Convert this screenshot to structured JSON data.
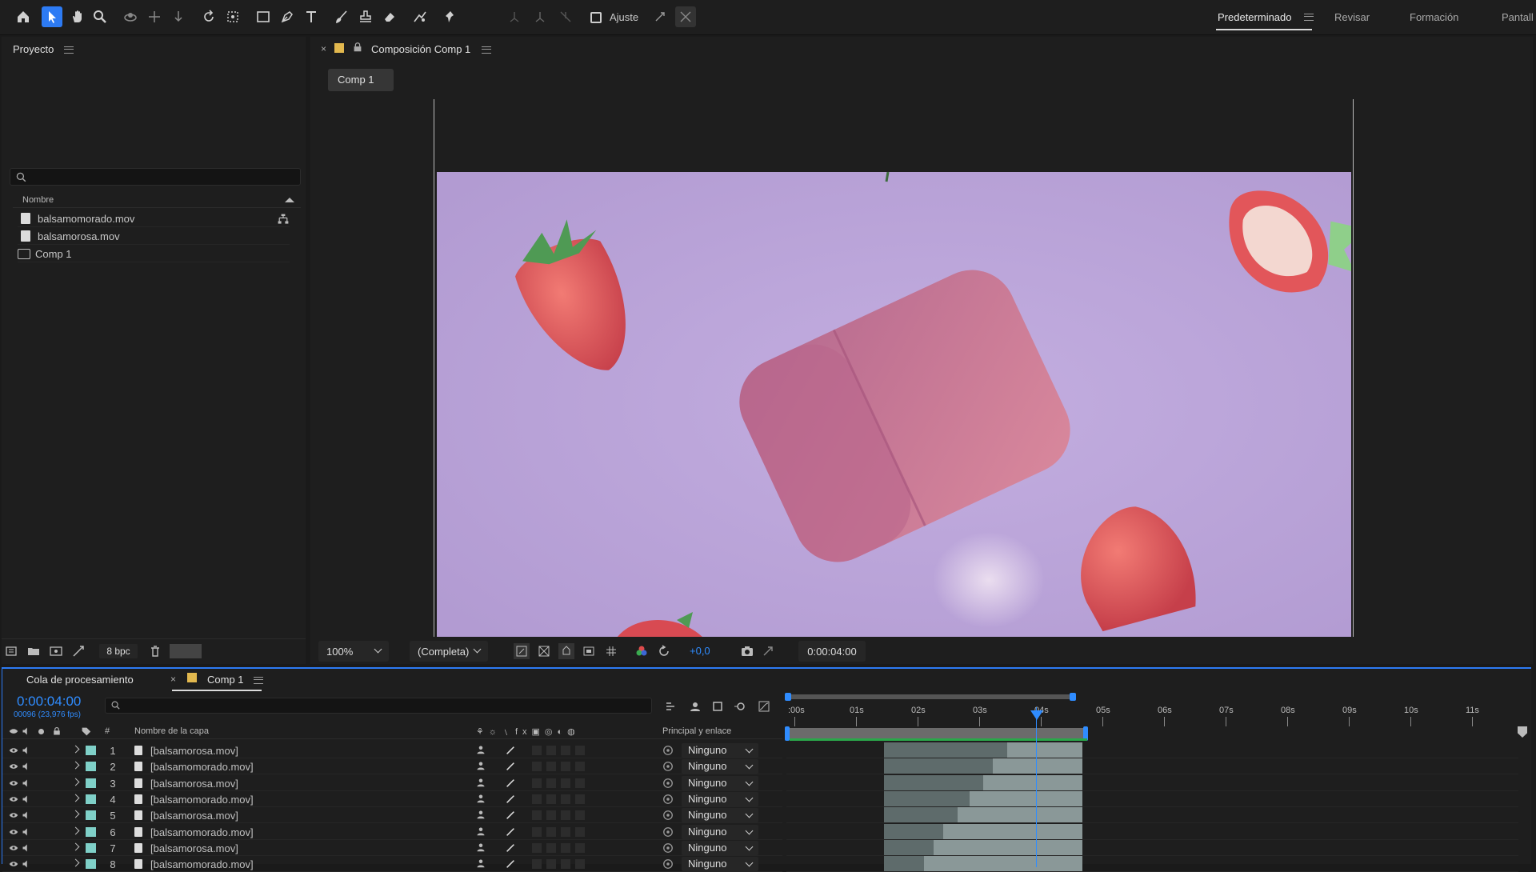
{
  "toolbar": {
    "tools": [
      "home-icon",
      "selection-icon",
      "hand-icon",
      "zoom-icon",
      "orbit-icon",
      "pan-icon",
      "dolly-icon",
      "rotate-icon",
      "anchor-icon",
      "rectangle-icon",
      "pen-icon",
      "type-icon",
      "brush-icon",
      "stamp-icon",
      "eraser-icon",
      "roto-brush-icon",
      "puppet-icon"
    ],
    "snap_label": "Ajuste",
    "workspaces": [
      "Predeterminado",
      "Revisar",
      "Formación",
      "Pantall"
    ]
  },
  "project": {
    "title": "Proyecto",
    "column_name": "Nombre",
    "items": [
      {
        "name": "balsamomorado.mov",
        "type": "file"
      },
      {
        "name": "balsamorosa.mov",
        "type": "file"
      },
      {
        "name": "Comp 1",
        "type": "comp"
      }
    ],
    "bpc": "8 bpc"
  },
  "viewer": {
    "close": "×",
    "title": "Composición Comp 1",
    "tab": "Comp 1",
    "zoom": "100%",
    "resolution": "(Completa)",
    "exposure": "+0,0",
    "timecode": "0:00:04:00"
  },
  "timeline": {
    "render_queue": "Cola de procesamiento",
    "tab": "Comp 1",
    "time": "0:00:04:00",
    "fps": "00096 (23,976 fps)",
    "col_num": "#",
    "col_name": "Nombre de la capa",
    "col_parent": "Principal y enlace",
    "ruler": [
      ":00s",
      "01s",
      "02s",
      "03s",
      "04s",
      "05s",
      "06s",
      "07s",
      "08s",
      "09s",
      "10s",
      "11s"
    ],
    "layers": [
      {
        "num": "1",
        "name": "[balsamorosa.mov]",
        "parent": "Ninguno",
        "light_start": 0.62
      },
      {
        "num": "2",
        "name": "[balsamomorado.mov]",
        "parent": "Ninguno",
        "light_start": 0.55
      },
      {
        "num": "3",
        "name": "[balsamorosa.mov]",
        "parent": "Ninguno",
        "light_start": 0.5
      },
      {
        "num": "4",
        "name": "[balsamomorado.mov]",
        "parent": "Ninguno",
        "light_start": 0.43
      },
      {
        "num": "5",
        "name": "[balsamorosa.mov]",
        "parent": "Ninguno",
        "light_start": 0.37
      },
      {
        "num": "6",
        "name": "[balsamomorado.mov]",
        "parent": "Ninguno",
        "light_start": 0.3
      },
      {
        "num": "7",
        "name": "[balsamorosa.mov]",
        "parent": "Ninguno",
        "light_start": 0.25
      },
      {
        "num": "8",
        "name": "[balsamomorado.mov]",
        "parent": "Ninguno",
        "light_start": 0.2
      }
    ]
  },
  "colors": {
    "accent": "#2d7bf4",
    "canvas": "#b9a2d8",
    "time_blue": "#2f8cff",
    "label_aqua": "#7fd0c8"
  }
}
